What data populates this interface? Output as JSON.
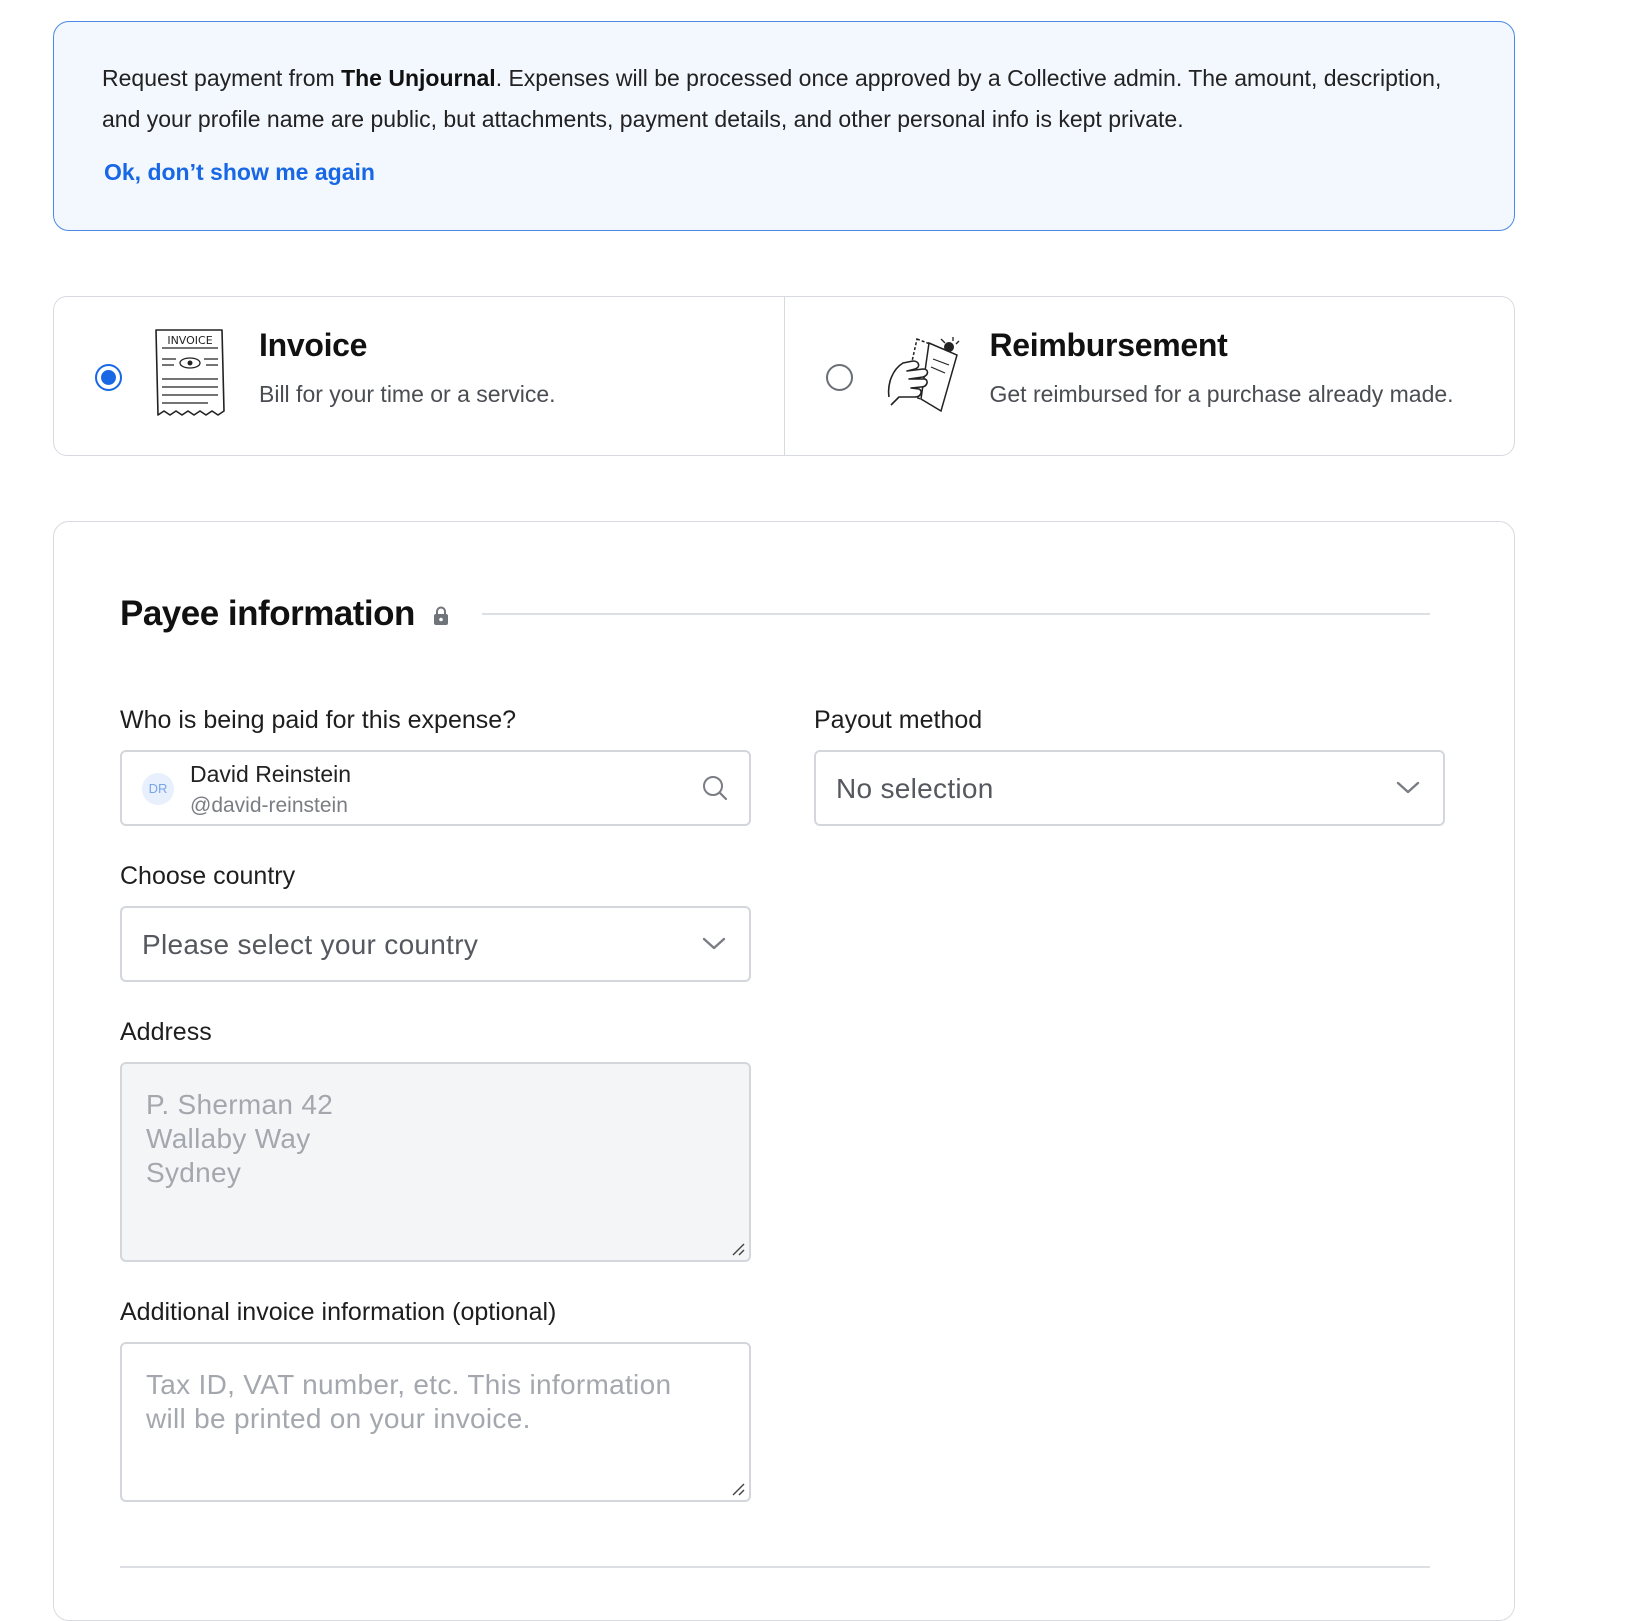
{
  "banner": {
    "text_before": "Request payment from ",
    "collective_name": "The Unjournal",
    "text_after": ". Expenses will be processed once approved by a Collective admin. The amount, description, and your profile name are public, but attachments, payment details, and other personal info is kept private.",
    "dismiss_link": "Ok, don’t show me again"
  },
  "expense_types": [
    {
      "title": "Invoice",
      "description": "Bill for your time or a service.",
      "selected": true,
      "illustration_text": "INVOICE"
    },
    {
      "title": "Reimbursement",
      "description": "Get reimbursed for a purchase already made.",
      "selected": false
    }
  ],
  "payee_section": {
    "title": "Payee information",
    "payee_label": "Who is being paid for this expense?",
    "payee": {
      "initials": "DR",
      "name": "David Reinstein",
      "slug": "@david-reinstein"
    },
    "payout_label": "Payout method",
    "payout_value": "No selection",
    "country_label": "Choose country",
    "country_value": "Please select your country",
    "address_label": "Address",
    "address_placeholder": "P. Sherman 42\nWallaby Way\nSydney",
    "additional_label": "Additional invoice information (optional)",
    "additional_placeholder": "Tax ID, VAT number, etc. This information\nwill be printed on your invoice."
  },
  "icons": {
    "lock": "lock-icon",
    "search": "search-icon",
    "chevron": "chevron-down-icon",
    "resize": "resize-handle-icon"
  },
  "colors": {
    "accent": "#1868e6",
    "banner_bg": "#f3f7fe",
    "banner_border": "#4b89e8",
    "border": "#d7dae0",
    "disabled_bg": "#f4f5f7"
  }
}
